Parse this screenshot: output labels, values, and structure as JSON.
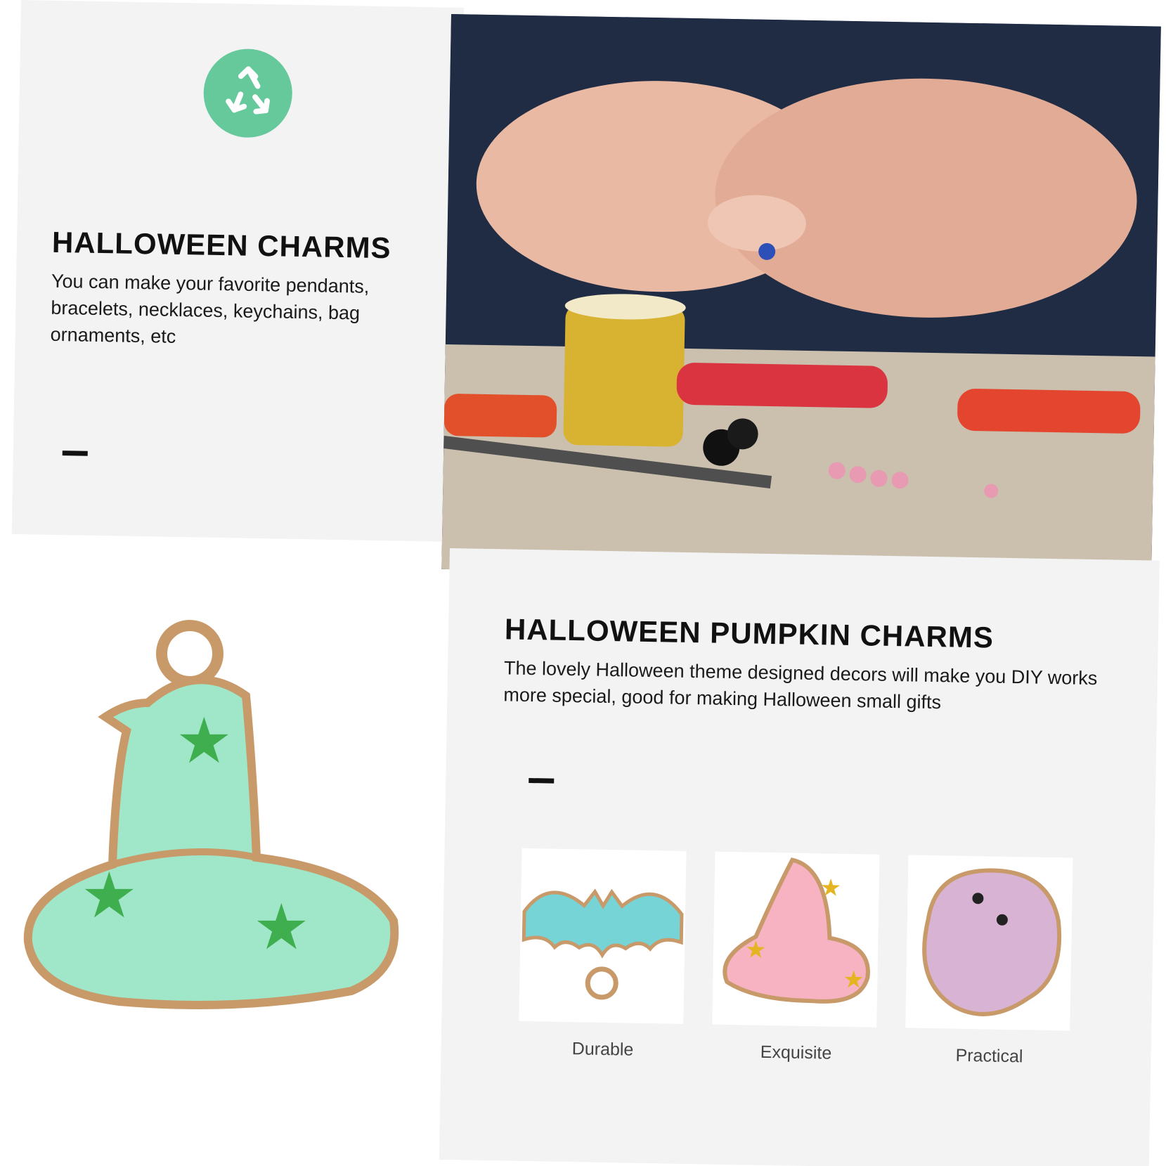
{
  "top_section": {
    "heading": "HALLOWEEN CHARMS",
    "description": "You can make your favorite pendants, bracelets, necklaces, keychains, bag ornaments, etc",
    "badge_icon": "recycle-icon",
    "badge_color": "#66c99b"
  },
  "bottom_section": {
    "heading": "HALLOWEEN PUMPKIN CHARMS",
    "description": "The lovely Halloween theme designed decors will make you DIY works more special, good for making Halloween small gifts"
  },
  "features": [
    {
      "label": "Durable",
      "icon": "bat-charm-icon"
    },
    {
      "label": "Exquisite",
      "icon": "witch-hat-charm-icon"
    },
    {
      "label": "Practical",
      "icon": "ghost-charm-icon"
    }
  ],
  "colors": {
    "mint": "#9fe7c8",
    "star_green": "#3fae4f",
    "gold": "#c89a6a",
    "pink": "#f7b3c2",
    "lilac": "#d9b3d4",
    "teal": "#76d3d6"
  }
}
